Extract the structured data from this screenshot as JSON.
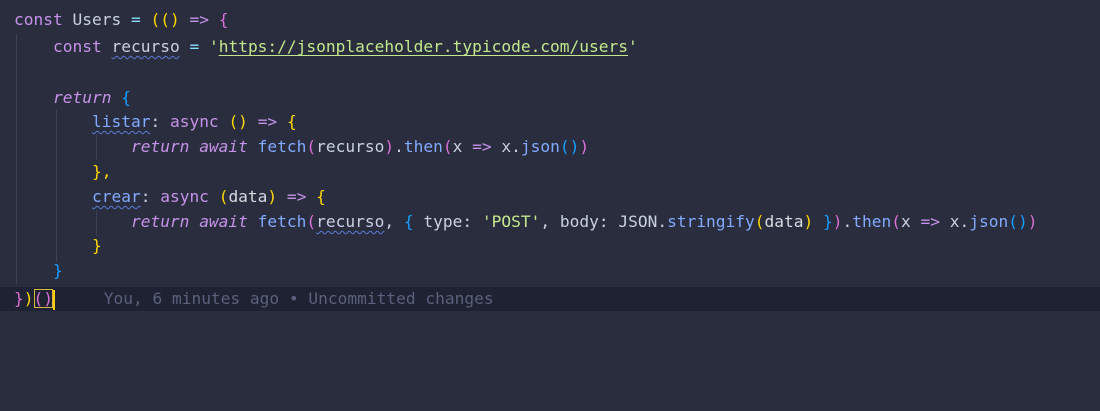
{
  "code": {
    "l1": {
      "kw_const": "const",
      "name": "Users",
      "eq": "=",
      "open": "((",
      "paren_close": ")",
      "arrow": "=>",
      "brace": "{"
    },
    "l2": {
      "kw_const": "const",
      "name": "recurso",
      "eq": "=",
      "quote_open": "'",
      "url": "https://jsonplaceholder.typicode.com/users",
      "quote_close": "'"
    },
    "l4": {
      "kw_return": "return",
      "brace": "{"
    },
    "l5": {
      "prop": "listar",
      "colon": ":",
      "kw_async": "async",
      "parens": "()",
      "arrow": "=>",
      "brace": "{"
    },
    "l6": {
      "kw_return": "return",
      "kw_await": "await",
      "fn_fetch": "fetch",
      "p_open": "(",
      "arg": "recurso",
      "p_close": ")",
      "dot": ".",
      "fn_then": "then",
      "p2_open": "(",
      "x1": "x",
      "arrow": "=>",
      "x2": "x",
      "dot2": ".",
      "fn_json": "json",
      "p3": "()",
      "p2_close": ")"
    },
    "l7": {
      "close": "},"
    },
    "l8": {
      "prop": "crear",
      "colon": ":",
      "kw_async": "async",
      "p_open": "(",
      "param": "data",
      "p_close": ")",
      "arrow": "=>",
      "brace": "{"
    },
    "l9": {
      "kw_return": "return",
      "kw_await": "await",
      "fn_fetch": "fetch",
      "p_open": "(",
      "arg": "recurso",
      "comma": ",",
      "obj_open": "{",
      "k_type": "type",
      "colon1": ":",
      "v_type": "'POST'",
      "comma2": ",",
      "k_body": "body",
      "colon2": ":",
      "json_obj": "JSON",
      "dot": ".",
      "fn_stringify": "stringify",
      "p2_open": "(",
      "data": "data",
      "p2_close": ")",
      "obj_close": "}",
      "p_close": ")",
      "dot2": ".",
      "fn_then": "then",
      "p3_open": "(",
      "x1": "x",
      "arrow": "=>",
      "x2": "x",
      "dot3": ".",
      "fn_json": "json",
      "p4": "()",
      "p3_close": ")"
    },
    "l10": {
      "close": "}"
    },
    "l11": {
      "close": "}"
    },
    "l12": {
      "brace": "}",
      "paren_close": ")",
      "call": "()",
      "blame": "You, 6 minutes ago • Uncommitted changes"
    }
  }
}
